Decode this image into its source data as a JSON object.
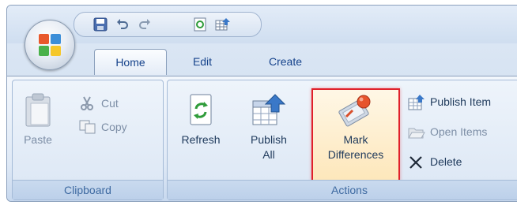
{
  "tabs": [
    {
      "label": "Home",
      "active": true
    },
    {
      "label": "Edit",
      "active": false
    },
    {
      "label": "Create",
      "active": false
    }
  ],
  "quick_access": [
    "save-icon",
    "undo-icon",
    "redo-icon",
    "refresh-icon",
    "publish-icon"
  ],
  "groups": {
    "clipboard": {
      "label": "Clipboard",
      "paste": "Paste",
      "cut": "Cut",
      "copy": "Copy"
    },
    "actions": {
      "label": "Actions",
      "refresh": "Refresh",
      "publish_all_line1": "Publish",
      "publish_all_line2": "All",
      "mark_differences_line1": "Mark",
      "mark_differences_line2": "Differences",
      "publish_item": "Publish Item",
      "open_items": "Open Items",
      "delete": "Delete"
    }
  },
  "colors": {
    "highlight_border": "#e0202a",
    "tab_text": "#15428b",
    "group_label": "#3e6aa1"
  }
}
